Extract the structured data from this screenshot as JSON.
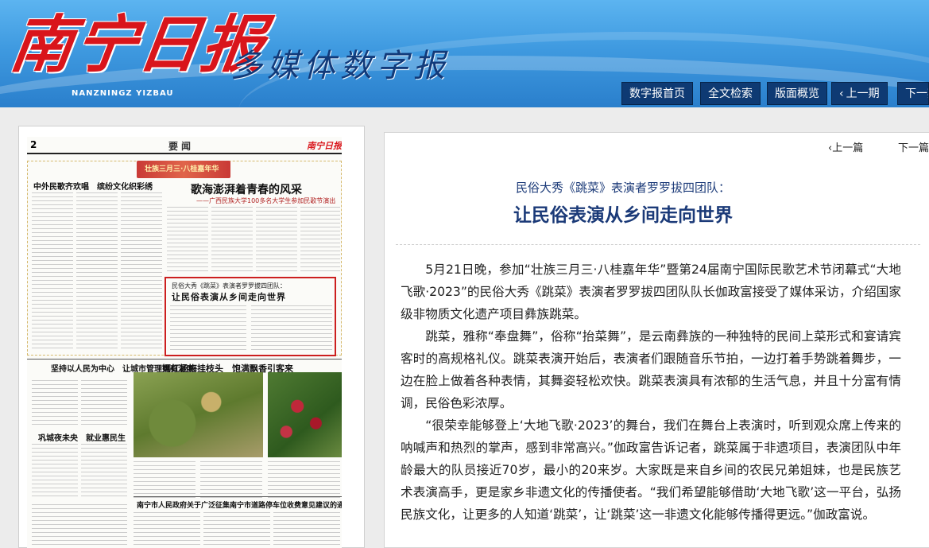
{
  "header": {
    "logo_main": "南宁日报",
    "logo_sub": "多媒体数字报",
    "logo_pinyin": "NANZNINGZ YIZBAU",
    "nav": {
      "home": "数字报首页",
      "search": "全文检索",
      "overview": "版面概览",
      "prev_issue": "上一期",
      "next_issue": "下一期"
    }
  },
  "newspaper": {
    "page_number": "2",
    "section": "要闻",
    "masthead": "南宁日报",
    "banner": "壮族三月三·八桂嘉年华",
    "headline_left": "中外民歌齐欢唱　缤纷文化织彩绣",
    "headline_main": "歌海澎湃着青春的风采",
    "headline_main_sub": "——广西民族大学100多名大学生参加民歌节演出",
    "highlight_kicker": "民俗大秀《跳菜》表演者罗罗拔四团队：",
    "highlight_title": "让民俗表演从乡间走向世界",
    "headline_lower_left": "坚持以人民为中心　让城市管理更有温度",
    "headline_lower_left2": "巩城夜未央　就业惠民生",
    "headline_photo": "嫣红杨梅挂枝头　饱满飘香引客来",
    "headline_bottom": "南宁市人民政府关于广泛征集南宁市道路停车位收费意见建议的通告"
  },
  "article_nav": {
    "prev": "上一篇",
    "next": "下一篇"
  },
  "article": {
    "subtitle": "民俗大秀《跳菜》表演者罗罗拔四团队：",
    "title": "让民俗表演从乡间走向世界",
    "paragraphs": [
      "5月21日晚，参加“壮族三月三·八桂嘉年华”暨第24届南宁国际民歌艺术节闭幕式“大地飞歌·2023”的民俗大秀《跳菜》表演者罗罗拔四团队队长伽政富接受了媒体采访，介绍国家级非物质文化遗产项目彝族跳菜。",
      "跳菜，雅称“奉盘舞”，俗称“抬菜舞”，是云南彝族的一种独特的民间上菜形式和宴请宾客时的高规格礼仪。跳菜表演开始后，表演者们跟随音乐节拍，一边打着手势跳着舞步，一边在脸上做着各种表情，其舞姿轻松欢快。跳菜表演具有浓郁的生活气息，并且十分富有情调，民俗色彩浓厚。",
      "“很荣幸能够登上‘大地飞歌·2023’的舞台，我们在舞台上表演时，听到观众席上传来的呐喊声和热烈的掌声，感到非常高兴。”伽政富告诉记者，跳菜属于非遗项目，表演团队中年龄最大的队员接近70岁，最小的20来岁。大家既是来自乡间的农民兄弟姐妹，也是民族艺术表演高手，更是家乡非遗文化的传播使者。“我们希望能够借助‘大地飞歌’这一平台，弘扬民族文化，让更多的人知道‘跳菜’，让‘跳菜’这一非遗文化能够传播得更远。”伽政富说。"
    ]
  },
  "colors": {
    "header_blue": "#3f9ae0",
    "nav_button": "#0e3a73",
    "logo_red": "#d9151b",
    "title_blue": "#1b3a78",
    "highlight_border": "#cc1f1f"
  }
}
